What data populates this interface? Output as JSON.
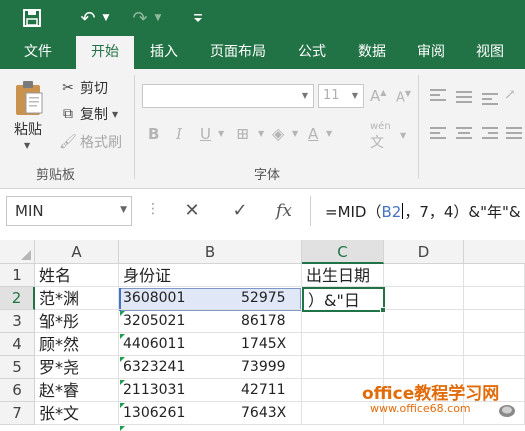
{
  "quick_access": {
    "save_icon": "save-icon",
    "undo_icon": "undo-icon",
    "redo_icon": "redo-icon",
    "customize_icon": "customize-icon"
  },
  "tabs": [
    {
      "label": "文件"
    },
    {
      "label": "开始"
    },
    {
      "label": "插入"
    },
    {
      "label": "页面布局"
    },
    {
      "label": "公式"
    },
    {
      "label": "数据"
    },
    {
      "label": "审阅"
    },
    {
      "label": "视图"
    }
  ],
  "ribbon": {
    "paste_label": "粘贴",
    "cut_label": "剪切",
    "copy_label": "复制",
    "format_painter_label": "格式刷",
    "clipboard_group": "剪贴板",
    "font_size": "11",
    "font_group": "字体",
    "wen_glyph": "wén"
  },
  "formula_bar": {
    "name_box": "MIN",
    "formula_prefix": "=MID（",
    "formula_ref": "B2",
    "formula_suffix": "，7，4）&\"年\"&"
  },
  "grid": {
    "columns": [
      "A",
      "B",
      "C",
      "D"
    ],
    "rows": [
      "1",
      "2",
      "3",
      "4",
      "5",
      "6",
      "7"
    ],
    "cells": {
      "A1": "姓名",
      "B1": "身份证",
      "C1": "出生日期",
      "C2": "）&\"日",
      "A2": "范*渊",
      "A3": "邹*彤",
      "A4": "顾*然",
      "A5": "罗*尧",
      "A6": "赵*睿",
      "A7": "张*文",
      "B2_left": "3608001",
      "B2_right": "52975",
      "B3_left": "3205021",
      "B3_right": "86178",
      "B4_left": "4406011",
      "B4_right": "1745X",
      "B5_left": "6323241",
      "B5_right": "73999",
      "B6_left": "2113031",
      "B6_right": "42711",
      "B7_left": "1306261",
      "B7_right": "7643X"
    }
  },
  "watermark": {
    "title": "office教程学习网",
    "url": "www.office68.com"
  },
  "colors": {
    "excel_green": "#217346",
    "ref_blue": "#4472c4",
    "watermark_orange": "#e26b0a"
  }
}
